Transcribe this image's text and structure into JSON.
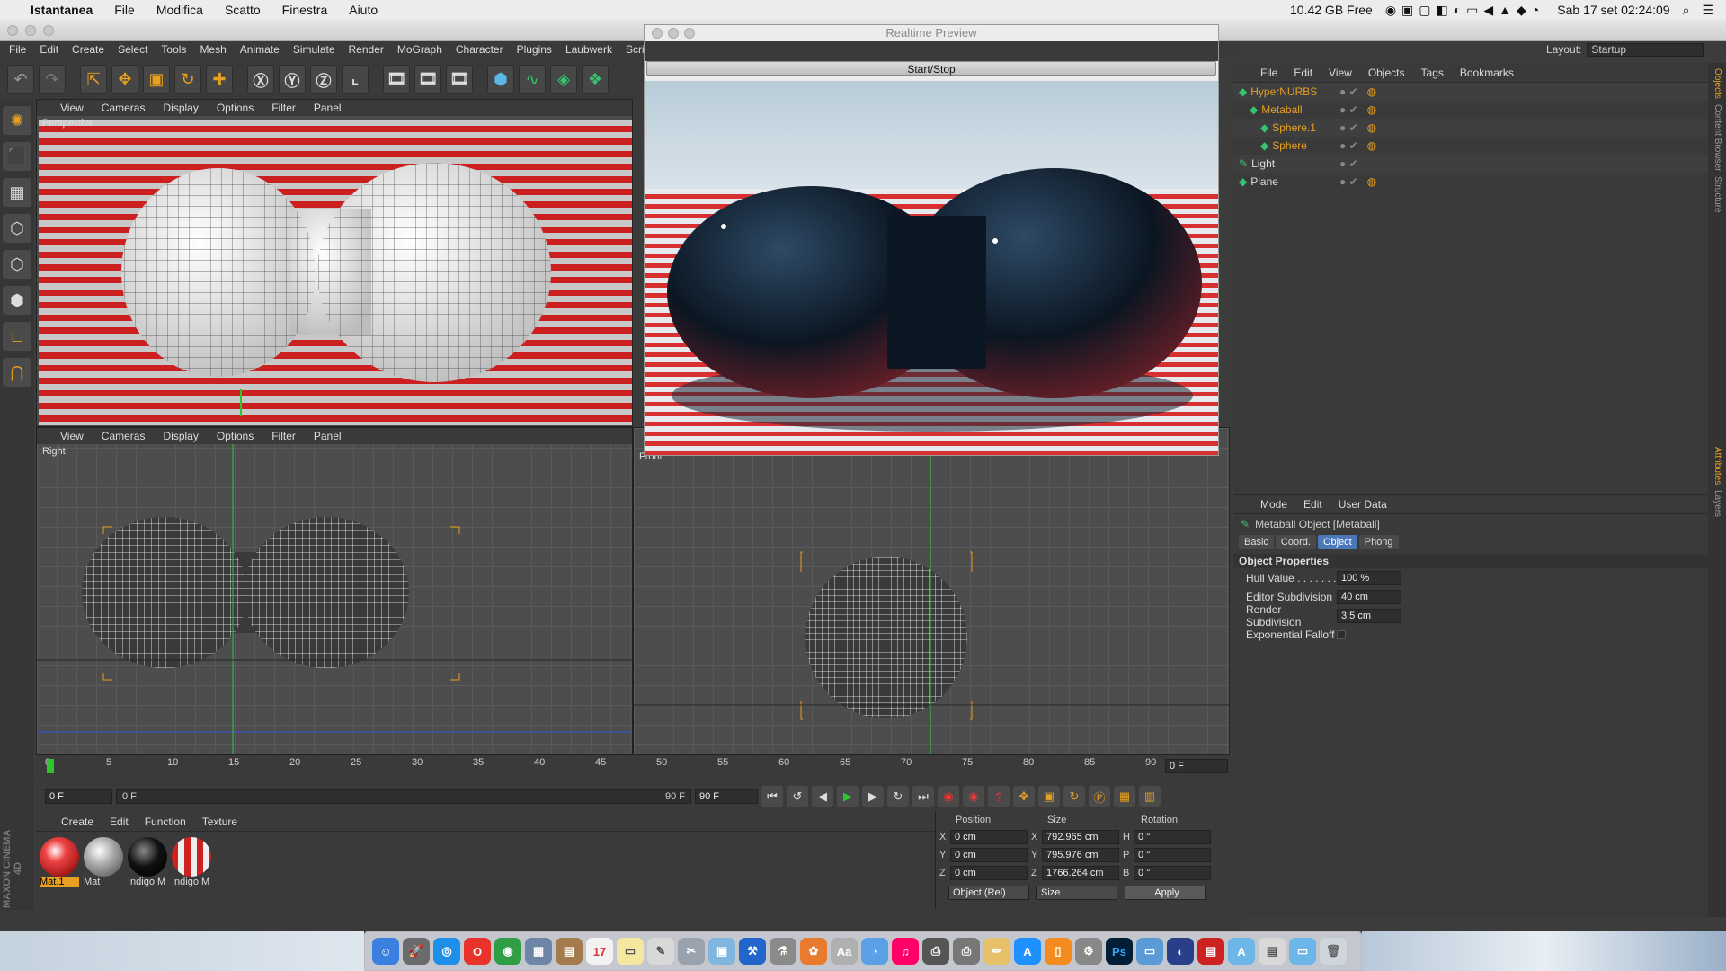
{
  "mac": {
    "apple": "",
    "app": "Istantanea",
    "menus": [
      "File",
      "Modifica",
      "Scatto",
      "Finestra",
      "Aiuto"
    ],
    "status": {
      "disk": "10.42 GB Free",
      "datetime": "Sab 17 set  02:24:09"
    }
  },
  "c4d": {
    "menus": [
      "File",
      "Edit",
      "Create",
      "Select",
      "Tools",
      "Mesh",
      "Animate",
      "Simulate",
      "Render",
      "MoGraph",
      "Character",
      "Plugins",
      "Laubwerk",
      "Script"
    ],
    "layout_label": "Layout:",
    "layout_value": "Startup"
  },
  "viewports": {
    "menu": [
      "View",
      "Cameras",
      "Display",
      "Options",
      "Filter",
      "Panel"
    ],
    "perspective": "Perspective",
    "right": "Right",
    "front": "Front"
  },
  "realtime": {
    "title": "Realtime Preview",
    "button": "Start/Stop"
  },
  "objects": {
    "menu": [
      "File",
      "Edit",
      "View",
      "Objects",
      "Tags",
      "Bookmarks"
    ],
    "items": [
      {
        "name": "HyperNURBS",
        "color": "#e8a020",
        "indent": 0
      },
      {
        "name": "Metaball",
        "color": "#e8a020",
        "indent": 1
      },
      {
        "name": "Sphere.1",
        "color": "#e8a020",
        "indent": 2
      },
      {
        "name": "Sphere",
        "color": "#e8a020",
        "indent": 2
      },
      {
        "name": "Light",
        "color": "#dddddd",
        "indent": 0
      },
      {
        "name": "Plane",
        "color": "#dddddd",
        "indent": 0
      }
    ]
  },
  "attributes": {
    "menu": [
      "Mode",
      "Edit",
      "User Data"
    ],
    "object_title": "Metaball Object [Metaball]",
    "tabs": [
      "Basic",
      "Coord.",
      "Object",
      "Phong"
    ],
    "active_tab": "Object",
    "section": "Object Properties",
    "props": [
      {
        "label": "Hull Value . . . . . . .",
        "value": "100 %"
      },
      {
        "label": "Editor Subdivision",
        "value": "40 cm"
      },
      {
        "label": "Render Subdivision",
        "value": "3.5 cm"
      },
      {
        "label": "Exponential Falloff",
        "value": ""
      }
    ]
  },
  "side_tabs": [
    "Objects",
    "Content Browser",
    "Structure",
    "Attributes",
    "Layers"
  ],
  "timeline": {
    "ticks": [
      "0",
      "5",
      "10",
      "15",
      "20",
      "25",
      "30",
      "35",
      "40",
      "45",
      "50",
      "55",
      "60",
      "65",
      "70",
      "75",
      "80",
      "85",
      "90"
    ],
    "current_frame": "0 F",
    "start": "0 F",
    "range_start": "0 F",
    "range_end": "90 F",
    "end": "90 F"
  },
  "materials": {
    "menu": [
      "Create",
      "Edit",
      "Function",
      "Texture"
    ],
    "items": [
      {
        "name": "Mat.1",
        "style": "red"
      },
      {
        "name": "Mat",
        "style": "grey"
      },
      {
        "name": "Indigo M",
        "style": "black"
      },
      {
        "name": "Indigo M",
        "style": "redwhite"
      }
    ]
  },
  "coords": {
    "headers": [
      "Position",
      "Size",
      "Rotation"
    ],
    "rows": [
      {
        "axis": "X",
        "pos": "0 cm",
        "sax": "X",
        "size": "792.965 cm",
        "rax": "H",
        "rot": "0 °"
      },
      {
        "axis": "Y",
        "pos": "0 cm",
        "sax": "Y",
        "size": "795.976 cm",
        "rax": "P",
        "rot": "0 °"
      },
      {
        "axis": "Z",
        "pos": "0 cm",
        "sax": "Z",
        "size": "1766.264 cm",
        "rax": "B",
        "rot": "0 °"
      }
    ],
    "mode1": "Object (Rel)",
    "mode2": "Size",
    "apply": "Apply"
  },
  "brand": "MAXON CINEMA 4D"
}
